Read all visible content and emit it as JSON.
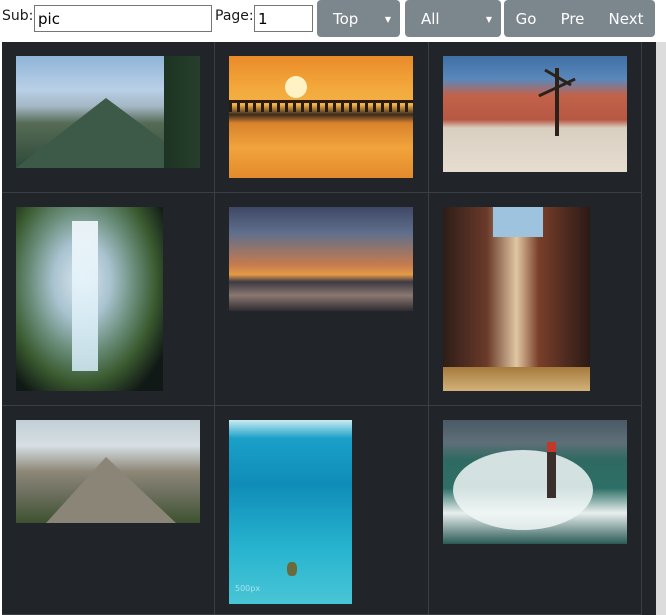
{
  "toolbar": {
    "sub_label": "Sub:",
    "sub_value": "pic",
    "page_label": "Page:",
    "page_value": "1",
    "sort_selected": "Top",
    "filter_selected": "All",
    "go_label": "Go",
    "pre_label": "Pre",
    "next_label": "Next"
  },
  "gallery": {
    "items": [
      {
        "subject": "forested mountain valley"
      },
      {
        "subject": "pier at sunset"
      },
      {
        "subject": "dead tree in desert dunes"
      },
      {
        "subject": "waterfall seen from cave"
      },
      {
        "subject": "city skyline at dusk"
      },
      {
        "subject": "narrow canyon"
      },
      {
        "subject": "rocky hillside"
      },
      {
        "subject": "diver in blue ocean",
        "watermark": "500px"
      },
      {
        "subject": "lighthouse in storm waves"
      }
    ]
  },
  "colors": {
    "gallery_background": "#212529",
    "button_background": "#7c868d",
    "button_text": "#ffffff"
  }
}
